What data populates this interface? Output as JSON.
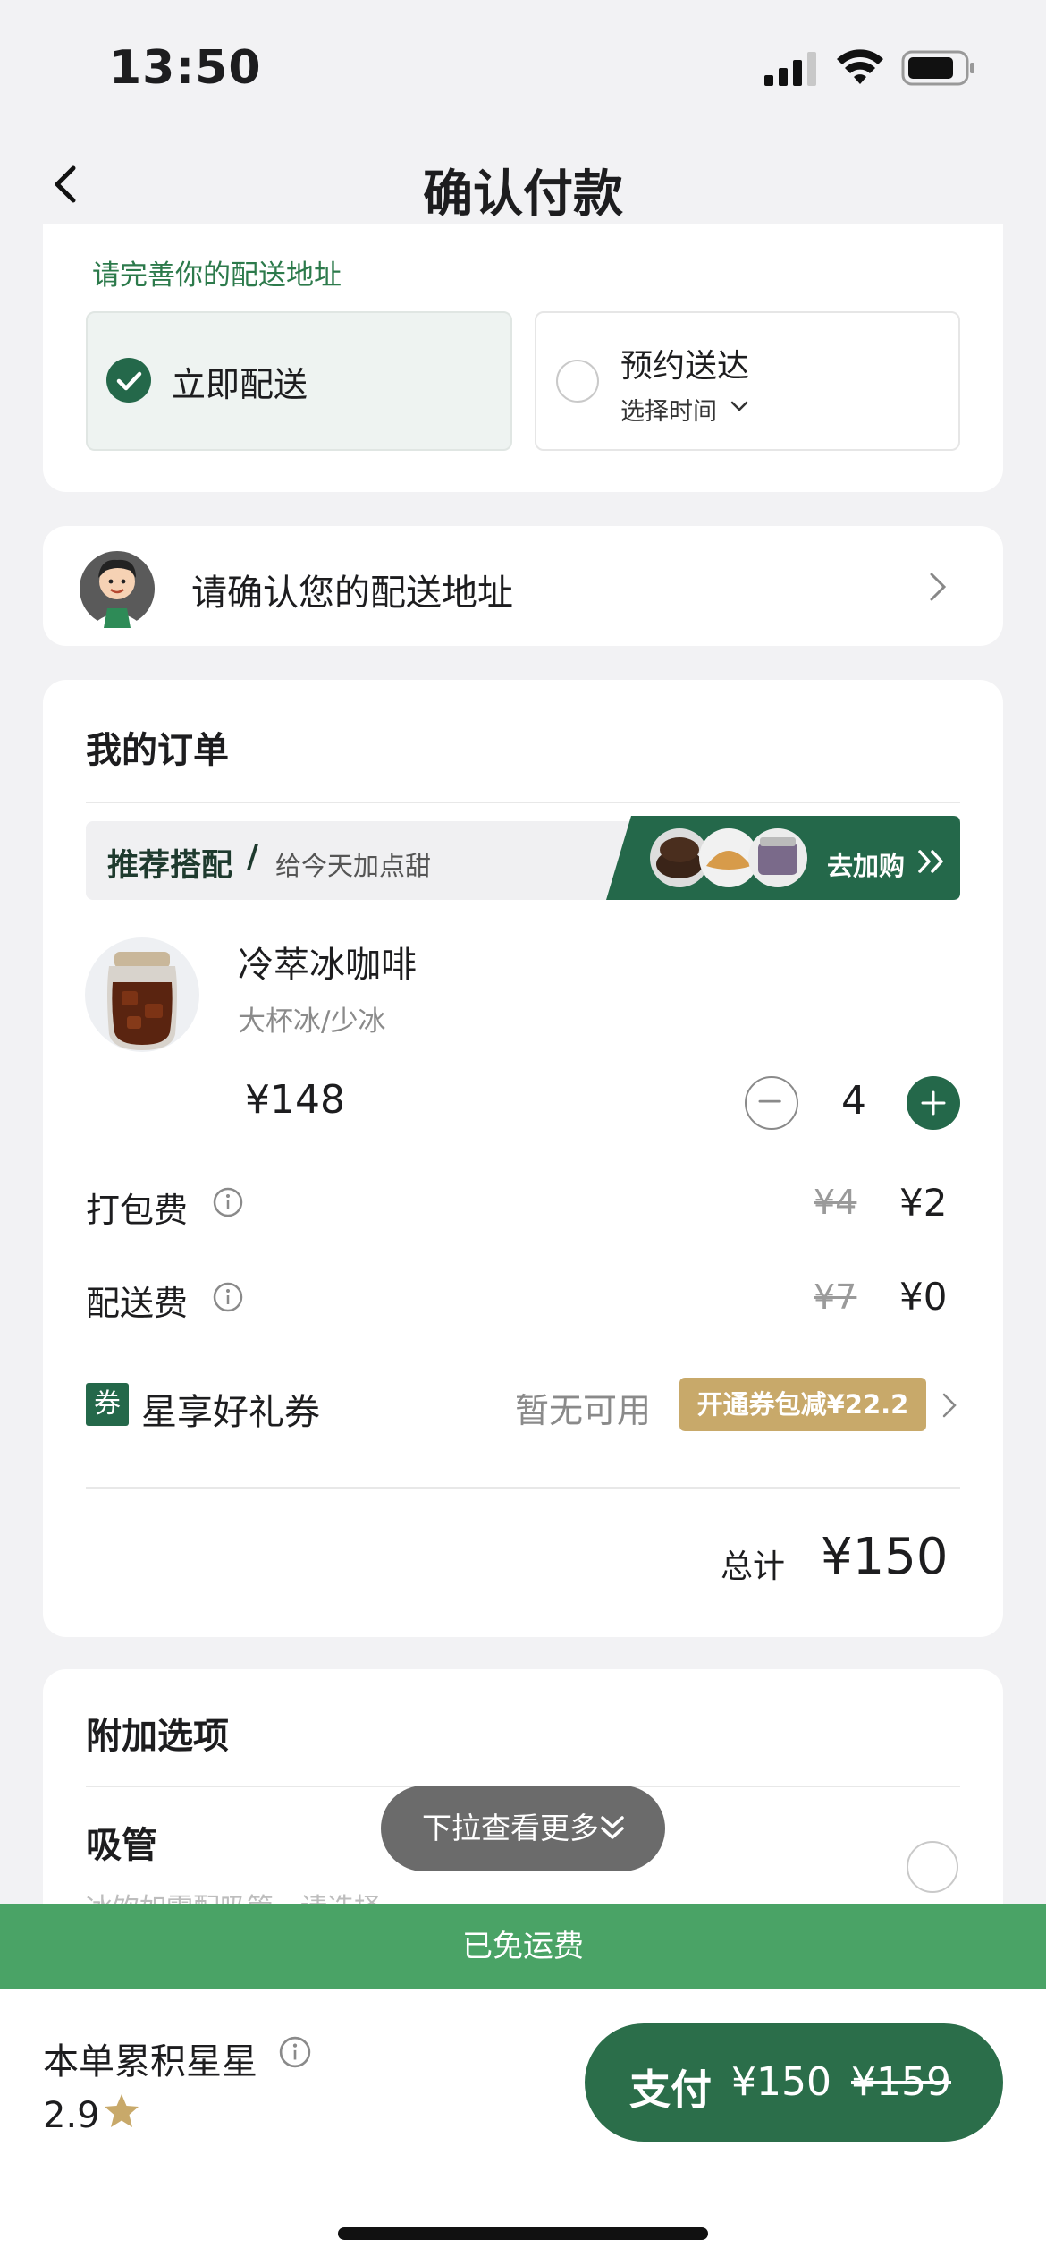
{
  "status_bar": {
    "time": "13:50"
  },
  "header": {
    "title": "确认付款"
  },
  "delivery": {
    "hint": "请完善你的配送地址",
    "now_label": "立即配送",
    "later_label": "预约送达",
    "later_sub": "选择时间"
  },
  "address": {
    "label": "请确认您的配送地址"
  },
  "order": {
    "title": "我的订单",
    "recommend": {
      "title": "推荐搭配",
      "slash": "/",
      "subtitle": "给今天加点甜",
      "cta": "去加购"
    },
    "item": {
      "name": "冷萃冰咖啡",
      "spec": "大杯冰/少冰",
      "price": "¥148",
      "quantity": "4"
    },
    "packing": {
      "label": "打包费",
      "old": "¥4",
      "new": "¥2"
    },
    "shipping": {
      "label": "配送费",
      "old": "¥7",
      "new": "¥0"
    },
    "coupon": {
      "icon_text": "券",
      "label": "星享好礼券",
      "status": "暂无可用",
      "badge": "开通券包减¥22.2"
    },
    "total": {
      "label": "总计",
      "value": "¥150"
    }
  },
  "extras": {
    "title": "附加选项",
    "straw_label": "吸管",
    "straw_hint": "冰饮如需配吸管，请选择"
  },
  "pull_more": "下拉查看更多",
  "free_shipping": "已免运费",
  "bottom": {
    "stars_label": "本单累积星星",
    "stars_value": "2.9",
    "pay_label": "支付",
    "pay_amount": "¥150",
    "pay_old": "¥159"
  },
  "colors": {
    "brand_green": "#24684a",
    "pay_green": "#2b6e4a",
    "notice_green": "#4aa366",
    "gold": "#c8a96a"
  }
}
